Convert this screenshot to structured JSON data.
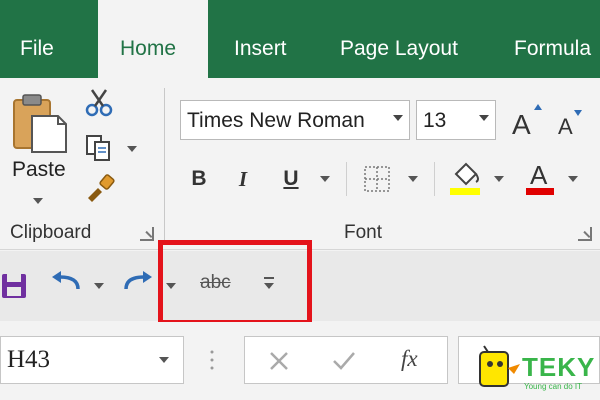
{
  "tabs": {
    "file": "File",
    "home": "Home",
    "insert": "Insert",
    "page_layout": "Page Layout",
    "formulas": "Formula"
  },
  "clipboard": {
    "paste_label": "Paste",
    "group_label": "Clipboard"
  },
  "font": {
    "font_name": "Times New Roman",
    "font_size": "13",
    "bold_label": "B",
    "italic_label": "I",
    "underline_label": "U",
    "group_label": "Font"
  },
  "qat": {
    "strikethrough_label": "abc"
  },
  "formula_bar": {
    "name_box_value": "H43",
    "fx_label": "fx"
  },
  "watermark": {
    "brand": "TEKY",
    "tagline": "Young can do IT"
  },
  "colors": {
    "ribbon_green": "#217346",
    "highlight_red": "#e4131b",
    "font_color_red": "#e00000",
    "fill_yellow": "#ffff00",
    "logo_green": "#39b54a"
  },
  "icons": {
    "paste": "clipboard-paste-icon",
    "cut": "scissors-icon",
    "copy": "copy-icon",
    "format_painter": "paintbrush-icon",
    "grow_font": "increase-font-size-icon",
    "shrink_font": "decrease-font-size-icon",
    "borders": "borders-icon",
    "fill_color": "paint-bucket-icon",
    "font_color": "font-color-icon",
    "save": "save-icon",
    "undo": "undo-icon",
    "redo": "redo-icon",
    "customize_qat": "customize-qat-icon",
    "cancel": "cancel-icon",
    "enter": "checkmark-icon"
  }
}
